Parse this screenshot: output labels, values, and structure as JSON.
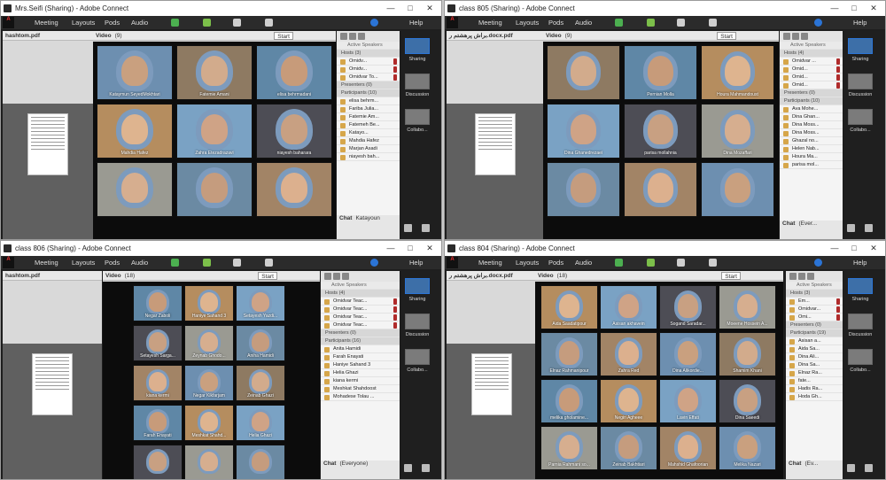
{
  "menu": {
    "meeting": "Meeting",
    "layouts": "Layouts",
    "pods": "Pods",
    "audio": "Audio",
    "help": "Help"
  },
  "labels": {
    "video": "Video",
    "attendees": "Attendees",
    "chat": "Chat",
    "start": "Start",
    "active_speakers": "Active Speakers",
    "sharing": "Sharing",
    "discussion": "Discussion",
    "collaboration": "Collabo..."
  },
  "colors": {
    "accent": "#2b74d6",
    "mic": "#b02b2b",
    "user": "#d6a64a"
  },
  "windows": [
    {
      "title": "Mrs.Seifi (Sharing) - Adobe Connect",
      "doc": "hashtom.pdf",
      "video_count": "(9)",
      "video_labels": [
        "Kataymun SeyedMokhtari",
        "Fatemie Amani",
        "elisa behrmadani",
        "Mahdia Hafez",
        "Zahra Etezadrazavi",
        "niayesh baharara",
        "",
        "",
        ""
      ],
      "hosts_title": "Hosts (3)",
      "hosts": [
        "Omidv...",
        "Omidv...",
        "Omidvar To..."
      ],
      "presenters_title": "Presenters (0)",
      "participants_title": "Participants (10)",
      "participants": [
        "elisa behrm...",
        "Fariba Julia...",
        "Fatemie Am...",
        "Fatemeh Be...",
        "Katayo...",
        "Mahdia Hafez",
        "Marjan Asadi",
        "niayesh bah..."
      ],
      "chat_title": "Chat",
      "chat_msg": "Katayoun"
    },
    {
      "title": "class 805 (Sharing) - Adobe Connect",
      "doc": "براش پرهشتم ر.docx.pdf",
      "video_count": "(9)",
      "video_labels": [
        "",
        "Pernian Molla",
        "Houra Mahmandoust",
        "Dina Ghanedrezaei",
        "parisa mollahnia",
        "Dina Mozaffari",
        "",
        "",
        ""
      ],
      "hosts_title": "Hosts (4)",
      "hosts": [
        "Omidvar ...",
        "Omid...",
        "Omid...",
        "Omid..."
      ],
      "presenters_title": "Presenters (0)",
      "participants_title": "Participants (10)",
      "participants": [
        "Ava Mohe...",
        "Dina Ghan...",
        "Dina Moss...",
        "Dina Moss...",
        "Ghazal no...",
        "Helen Nab...",
        "Houra Ma...",
        "parisa mol..."
      ],
      "chat_title": "Chat",
      "chat_msg": "(Ever..."
    },
    {
      "title": "class 806 (Sharing) - Adobe Connect",
      "doc": "hashtom.pdf",
      "video_count": "(18)",
      "video_labels": [
        "Negar Zaboli",
        "Haniye Sahand 3",
        "Setayesh Yazdi...",
        "Setayesh Sarga...",
        "Zeynab Ghodo...",
        "Aniha Hamidi",
        "kiana kermi",
        "Negar Kikfarjam",
        "Zeinab Ghazi",
        "Farah Enayati",
        "Meshkat Shahd...",
        "Helia Ghazi",
        "",
        "",
        ""
      ],
      "hosts_title": "Hosts (4)",
      "hosts": [
        "Omidvar Teac...",
        "Omidvar Teac...",
        "Omidvar Teac...",
        "Omidvar Teac..."
      ],
      "presenters_title": "Presenters (0)",
      "participants_title": "Participants (16)",
      "participants": [
        "Anita Hamidi",
        "Farah Enayati",
        "Haniye Sahand 3",
        "Helia Ghazi",
        "kiana kermi",
        "Meshkat Shahdoost",
        "Mohadese Tolau ..."
      ],
      "chat_title": "Chat",
      "chat_msg": "(Everyone)"
    },
    {
      "title": "class 804 (Sharing) - Adobe Connect",
      "doc": "براش پرهشتم ر.docx.pdf",
      "video_count": "(18)",
      "video_labels": [
        "Aida Saadatipour",
        "Asisan akhavein",
        "Sogand Saradar...",
        "Moeene Hossein A...",
        "Elnaz Rahmanipour",
        "Zahra Red",
        "Dina Alikordie...",
        "Shamim Khani",
        "melika gholamine...",
        "Negin Agheee",
        "Lavin Effati",
        "Dina Saeedi",
        "Parnia Rahmani so...",
        "Zeinab Bakhtiari",
        "Mahshid Ghafoorian",
        "Melika Nazari"
      ],
      "hosts_title": "Hosts (3)",
      "hosts": [
        "Em...",
        "Omidvar...",
        "Omi..."
      ],
      "presenters_title": "Presenters (0)",
      "participants_title": "Participants (19)",
      "participants": [
        "Asisan a...",
        "Aida Sa...",
        "Dina Ali...",
        "Dina Sa...",
        "Elnaz Ra...",
        "fate...",
        "Hadis Ra...",
        "Hoda Gh..."
      ],
      "chat_title": "Chat",
      "chat_msg": "(Ev..."
    }
  ]
}
